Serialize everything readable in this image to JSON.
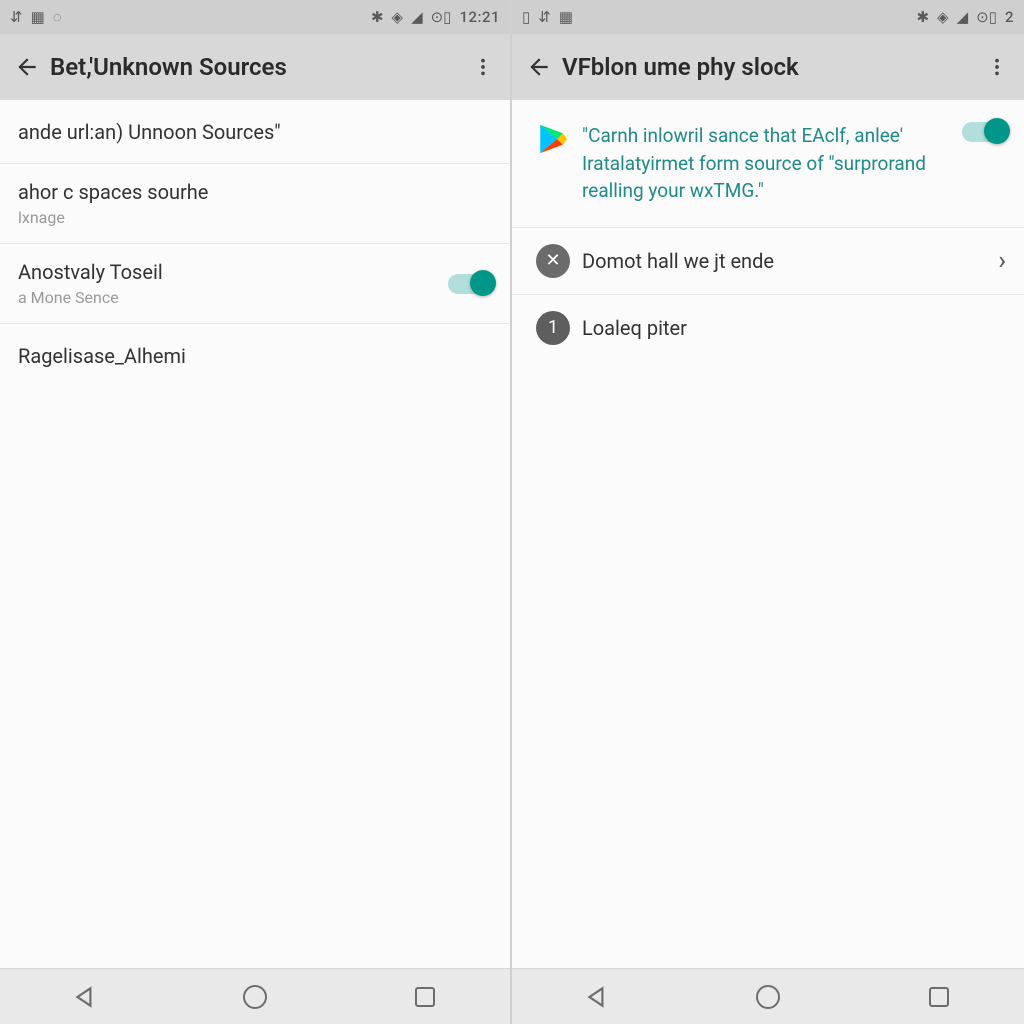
{
  "status": {
    "left_glyphs": [
      "⇵",
      "▦",
      "◌"
    ],
    "right_glyphs": [
      "✱",
      "◈",
      "◢",
      "⊙▯"
    ],
    "clock": "12:21"
  },
  "status_right": {
    "left_glyphs": [
      "▯",
      "⇵",
      "▦"
    ],
    "right_glyphs": [
      "✱",
      "◈",
      "◢",
      "⊙▯"
    ],
    "clock": "2"
  },
  "left": {
    "title": "Bet,'Unknown Sources",
    "rows": [
      {
        "primary": "ande url:an) Unnoon Sources\""
      },
      {
        "primary": "ahor c spaces sourhe",
        "secondary": "lxnage"
      },
      {
        "primary": "Anostvaly Toseil",
        "secondary": "a Mone Sence",
        "toggle": true
      },
      {
        "primary": "Ragelisase_Alhemi"
      }
    ]
  },
  "right": {
    "title": "VFblon ume phy slock",
    "info": "\"Carnh inlowril sance that EAclf, anlee' Iratalatyirmet form source of \"surprorand realling your wxTMG.\"",
    "rows": [
      {
        "icon": "x",
        "primary": "Domot hall we jt ende",
        "chevron": true
      },
      {
        "icon": "1",
        "primary": "Loaleq piter"
      }
    ]
  }
}
